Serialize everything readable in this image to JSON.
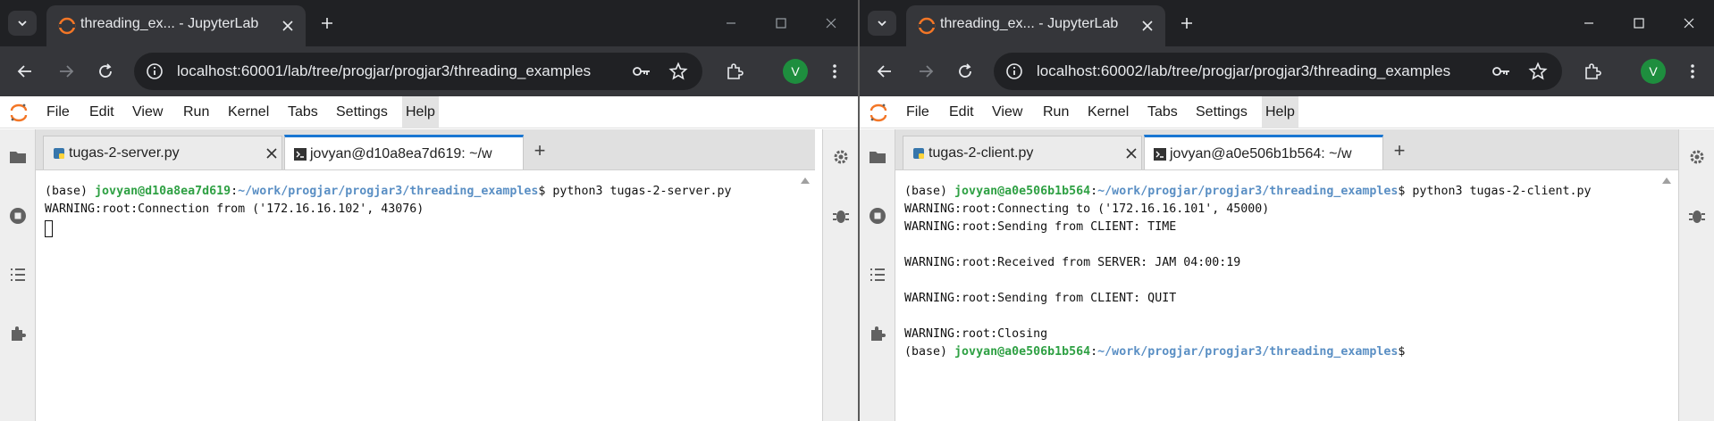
{
  "windows": [
    {
      "tab_title": "threading_ex... - JupyterLab",
      "url": "localhost:60001/lab/tree/progjar/progjar3/threading_examples",
      "avatar_letter": "V",
      "menu": [
        "File",
        "Edit",
        "View",
        "Run",
        "Kernel",
        "Tabs",
        "Settings",
        "Help"
      ],
      "tabs": [
        {
          "label": "tugas-2-server.py"
        },
        {
          "label": "jovyan@d10a8ea7d619: ~/w"
        }
      ],
      "terminal": {
        "lines": [
          {
            "base": "(base) ",
            "user": "jovyan@d10a8ea7d619",
            "sep": ":",
            "path": "~/work/progjar/progjar3/threading_examples",
            "cmd": "$ python3 tugas-2-server.py"
          },
          {
            "text": "WARNING:root:Connection from ('172.16.16.102', 43076)"
          }
        ]
      }
    },
    {
      "tab_title": "threading_ex... - JupyterLab",
      "url": "localhost:60002/lab/tree/progjar/progjar3/threading_examples",
      "avatar_letter": "V",
      "menu": [
        "File",
        "Edit",
        "View",
        "Run",
        "Kernel",
        "Tabs",
        "Settings",
        "Help"
      ],
      "tabs": [
        {
          "label": "tugas-2-client.py"
        },
        {
          "label": "jovyan@a0e506b1b564: ~/w"
        }
      ],
      "terminal": {
        "lines": [
          {
            "base": "(base) ",
            "user": "jovyan@a0e506b1b564",
            "sep": ":",
            "path": "~/work/progjar/progjar3/threading_examples",
            "cmd": "$ python3 tugas-2-client.py"
          },
          {
            "text": "WARNING:root:Connecting to ('172.16.16.101', 45000)"
          },
          {
            "text": "WARNING:root:Sending from CLIENT: TIME"
          },
          {
            "text": "WARNING:root:Received from SERVER: JAM 04:00:19"
          },
          {
            "text": "WARNING:root:Sending from CLIENT: QUIT"
          },
          {
            "text": "WARNING:root:Closing"
          },
          {
            "base": "(base) ",
            "user": "jovyan@a0e506b1b564",
            "sep": ":",
            "path": "~/work/progjar/progjar3/threading_examples",
            "cmd": "$"
          }
        ]
      }
    }
  ],
  "colors": {
    "chrome_bg": "#202124",
    "toolbar_bg": "#35363a",
    "active_tab_accent": "#1976d2",
    "prompt_user": "#2ea043",
    "prompt_path": "#5a8fc4",
    "avatar": "#1e8e3e",
    "jupyter_logo": "#f37626"
  }
}
